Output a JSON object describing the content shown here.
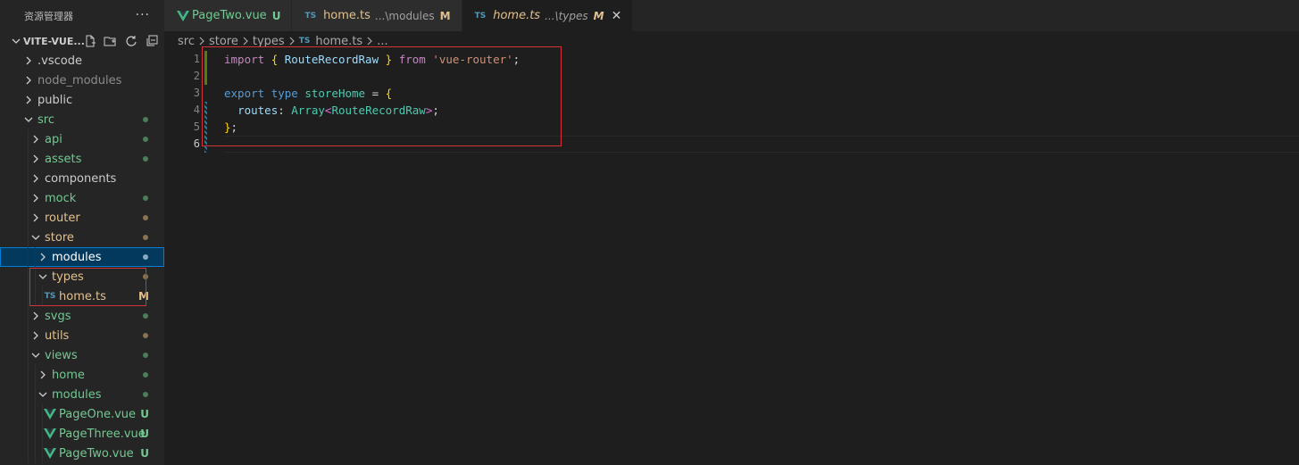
{
  "sidebar": {
    "title": "资源管理器",
    "more": "···",
    "project": "VITE-VUE...",
    "tree": [
      {
        "label": ".vscode",
        "depth": 0,
        "kind": "folder",
        "open": false,
        "color": "#cccccc"
      },
      {
        "label": "node_modules",
        "depth": 0,
        "kind": "folder",
        "open": false,
        "color": "#8c8c8c"
      },
      {
        "label": "public",
        "depth": 0,
        "kind": "folder",
        "open": false,
        "color": "#cccccc"
      },
      {
        "label": "src",
        "depth": 0,
        "kind": "folder",
        "open": true,
        "color": "#73c991",
        "dot": "#4b7d5a"
      },
      {
        "label": "api",
        "depth": 1,
        "kind": "folder",
        "open": false,
        "color": "#73c991",
        "dot": "#4b7d5a"
      },
      {
        "label": "assets",
        "depth": 1,
        "kind": "folder",
        "open": false,
        "color": "#73c991",
        "dot": "#4b7d5a"
      },
      {
        "label": "components",
        "depth": 1,
        "kind": "folder",
        "open": false,
        "color": "#cccccc"
      },
      {
        "label": "mock",
        "depth": 1,
        "kind": "folder",
        "open": false,
        "color": "#73c991",
        "dot": "#4b7d5a"
      },
      {
        "label": "router",
        "depth": 1,
        "kind": "folder",
        "open": false,
        "color": "#e2c08d",
        "dot": "#8a7350"
      },
      {
        "label": "store",
        "depth": 1,
        "kind": "folder",
        "open": true,
        "color": "#e2c08d",
        "dot": "#8a7350"
      },
      {
        "label": "modules",
        "depth": 2,
        "kind": "folder",
        "open": false,
        "color": "#ffffff",
        "dot": "#8aa9c4",
        "selected": true
      },
      {
        "label": "types",
        "depth": 2,
        "kind": "folder",
        "open": true,
        "color": "#e2c08d",
        "dot": "#8a7350"
      },
      {
        "label": "home.ts",
        "depth": 3,
        "kind": "ts",
        "color": "#e2c08d",
        "badge": "M"
      },
      {
        "label": "svgs",
        "depth": 1,
        "kind": "folder",
        "open": false,
        "color": "#73c991",
        "dot": "#4b7d5a"
      },
      {
        "label": "utils",
        "depth": 1,
        "kind": "folder",
        "open": false,
        "color": "#e2c08d",
        "dot": "#8a7350"
      },
      {
        "label": "views",
        "depth": 1,
        "kind": "folder",
        "open": true,
        "color": "#73c991",
        "dot": "#4b7d5a"
      },
      {
        "label": "home",
        "depth": 2,
        "kind": "folder",
        "open": false,
        "color": "#73c991",
        "dot": "#4b7d5a"
      },
      {
        "label": "modules",
        "depth": 2,
        "kind": "folder",
        "open": true,
        "color": "#73c991",
        "dot": "#4b7d5a"
      },
      {
        "label": "PageOne.vue",
        "depth": 3,
        "kind": "vue",
        "color": "#73c991",
        "badge": "U"
      },
      {
        "label": "PageThree.vue",
        "depth": 3,
        "kind": "vue",
        "color": "#73c991",
        "badge": "U"
      },
      {
        "label": "PageTwo.vue",
        "depth": 3,
        "kind": "vue",
        "color": "#73c991",
        "badge": "U"
      }
    ]
  },
  "tabs": [
    {
      "icon": "vue",
      "label": "PageTwo.vue",
      "desc": "",
      "status": "U",
      "label_color": "#73c991",
      "status_color": "#73c991",
      "active": false,
      "italic": false
    },
    {
      "icon": "ts",
      "label": "home.ts",
      "desc": "...\\modules",
      "status": "M",
      "label_color": "#e2c08d",
      "status_color": "#e2c08d",
      "active": false,
      "italic": false
    },
    {
      "icon": "ts",
      "label": "home.ts",
      "desc": "...\\types",
      "status": "M",
      "label_color": "#e2c08d",
      "status_color": "#e2c08d",
      "active": true,
      "italic": true,
      "close": "✕"
    }
  ],
  "breadcrumb": {
    "items": [
      "src",
      "store",
      "types",
      "home.ts",
      "..."
    ],
    "ts_label": "TS"
  },
  "editor": {
    "line_numbers": [
      "1",
      "2",
      "3",
      "4",
      "5",
      "6"
    ],
    "current_line": "6",
    "code": [
      [
        [
          "kw",
          "import"
        ],
        [
          "pl",
          " "
        ],
        [
          "br",
          "{"
        ],
        [
          "pl",
          " "
        ],
        [
          "id",
          "RouteRecordRaw"
        ],
        [
          "pl",
          " "
        ],
        [
          "br",
          "}"
        ],
        [
          "pl",
          " "
        ],
        [
          "kw",
          "from"
        ],
        [
          "pl",
          " "
        ],
        [
          "str",
          "'vue-router'"
        ],
        [
          "pl",
          ";"
        ]
      ],
      [],
      [
        [
          "kwb",
          "export"
        ],
        [
          "pl",
          " "
        ],
        [
          "kwb",
          "type"
        ],
        [
          "pl",
          " "
        ],
        [
          "ty",
          "storeHome"
        ],
        [
          "pl",
          " = "
        ],
        [
          "br",
          "{"
        ]
      ],
      [
        [
          "pl",
          "  "
        ],
        [
          "id",
          "routes"
        ],
        [
          "pl",
          ": "
        ],
        [
          "ty",
          "Array"
        ],
        [
          "br2",
          "<"
        ],
        [
          "ty",
          "RouteRecordRaw"
        ],
        [
          "br2",
          ">"
        ],
        [
          "pl",
          ";"
        ]
      ],
      [
        [
          "br",
          "}"
        ],
        [
          "pl",
          ";"
        ]
      ],
      []
    ]
  },
  "colors": {
    "accent": "#007fd4",
    "highlight_box": "#d13438",
    "added": "#587c0c",
    "modified": "#1b81a8"
  }
}
